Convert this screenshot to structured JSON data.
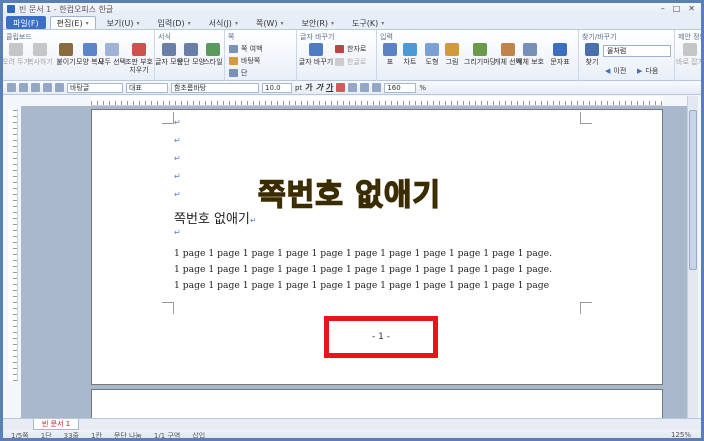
{
  "window": {
    "title": "빈 문서 1 - 한컴오피스 한글"
  },
  "menu": {
    "tabs": [
      {
        "label": "파일(F)"
      },
      {
        "label": "편집(E)"
      },
      {
        "label": "보기(U)"
      },
      {
        "label": "입력(D)"
      },
      {
        "label": "서식(J)"
      },
      {
        "label": "쪽(W)"
      },
      {
        "label": "보안(R)"
      },
      {
        "label": "도구(K)"
      }
    ]
  },
  "ribbon": {
    "groups": {
      "clipboard": "클립보드",
      "format": "서식",
      "page": "쪽",
      "charchange": "글자 바꾸기",
      "input": "입력",
      "find": "찾기/바꾸기",
      "proposal": "제안 정보"
    },
    "buttons": {
      "cut": "오려 두기",
      "copy": "복사하기",
      "paste": "붙이기",
      "shape_copy": "모양 복사",
      "select_all": "모두 선택",
      "clear_marks": "조판 부호 지우기",
      "char_shape": "글자 모양",
      "para_shape": "문단 모양",
      "style": "스타일",
      "page_margin": "쪽 여백",
      "page_border": "바탕쪽",
      "columns": "단",
      "char_change": "글자 바꾸기",
      "hanja": "한자로",
      "hangul": "한글로",
      "table": "표",
      "chart": "차트",
      "shape": "도형",
      "picture": "그림",
      "drawing": "그리기마당",
      "object_select": "개체 선택",
      "object_protect": "개체 보호",
      "symbol": "문자표",
      "find": "찾기",
      "prev": "이전",
      "next": "다음",
      "proposal": "바로 잡기"
    },
    "find_value": "올처럼"
  },
  "toolbar": {
    "style": "바탕글",
    "lang": "대표",
    "font": "함초롬바탕",
    "size": "10.0",
    "unit": "pt",
    "bold": "가",
    "italic": "가",
    "underline": "가",
    "zoom": "160",
    "zoom_unit": "%"
  },
  "document": {
    "overlay_title": "쪽번호 없애기",
    "heading": "쪽번호 없애기",
    "lines": [
      "1 page 1 page 1 page 1 page 1 page 1 page 1 page 1 page 1 page 1 page 1 page.",
      "1 page 1 page 1 page 1 page 1 page 1 page 1 page 1 page 1 page 1 page 1 page.",
      "1 page 1 page 1 page 1 page 1 page 1 page 1 page 1 page 1 page 1 page 1 page"
    ],
    "page_number": "- 1 -",
    "para_mark": "↵"
  },
  "tabs": {
    "doc": "빈 문서 1"
  },
  "status": {
    "page": "1/5쪽",
    "section": "1단",
    "line": "33줄",
    "col": "1칸",
    "para": "문단 나눔",
    "sect": "1/1 구역",
    "mode": "삽입",
    "zoom": "125%"
  },
  "colors": {
    "accent": "#3a6fc4",
    "highlight_box": "#e8141c",
    "title_fill": "#f4c224"
  }
}
